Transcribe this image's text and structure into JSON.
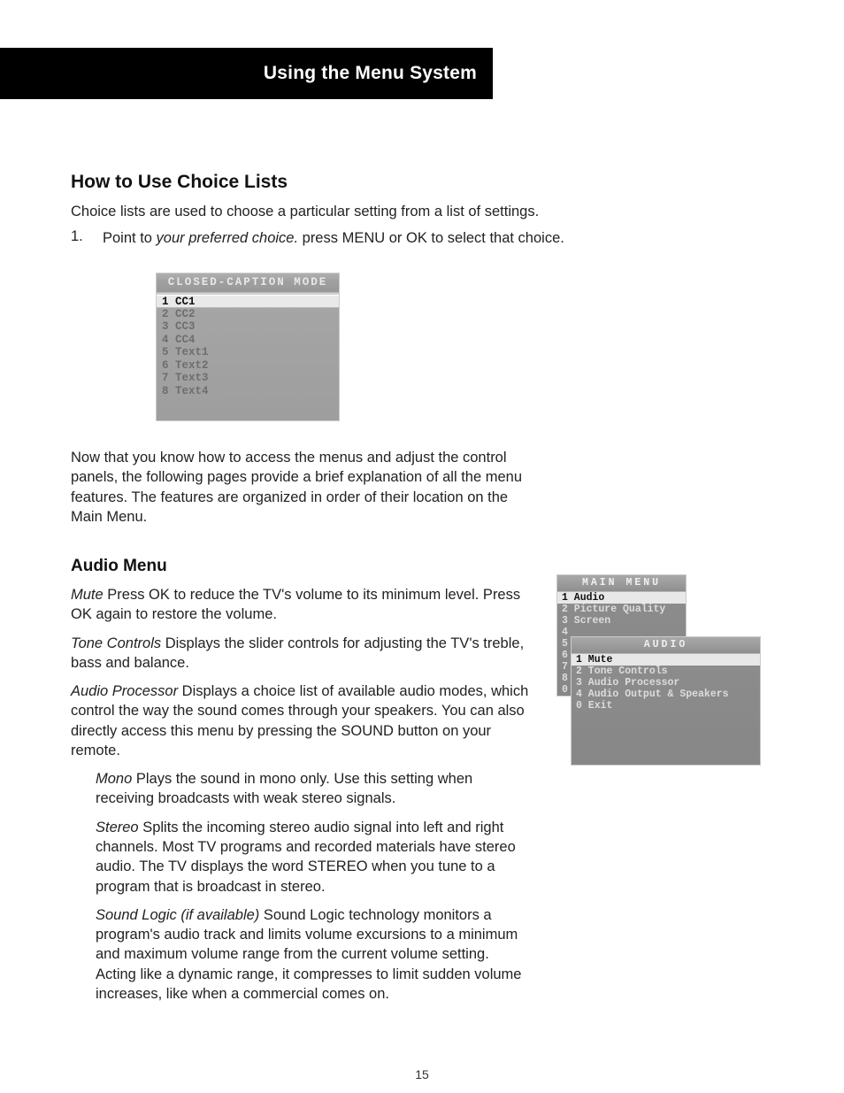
{
  "header": {
    "title": "Using the Menu System"
  },
  "section_choice": {
    "heading": "How to Use Choice Lists",
    "intro": "Choice lists are used to choose a particular setting from a list of settings.",
    "step_num": "1.",
    "step_a": "Point to ",
    "step_b_italic": "your preferred choice. ",
    "step_c": "press MENU or OK to select that choice."
  },
  "cc_panel": {
    "title": "CLOSED-CAPTION MODE",
    "items": [
      {
        "n": "1",
        "label": "CC1",
        "sel": true
      },
      {
        "n": "2",
        "label": "CC2",
        "sel": false
      },
      {
        "n": "3",
        "label": "CC3",
        "sel": false
      },
      {
        "n": "4",
        "label": "CC4",
        "sel": false
      },
      {
        "n": "5",
        "label": "Text1",
        "sel": false
      },
      {
        "n": "6",
        "label": "Text2",
        "sel": false
      },
      {
        "n": "7",
        "label": "Text3",
        "sel": false
      },
      {
        "n": "8",
        "label": "Text4",
        "sel": false
      }
    ]
  },
  "transition": "Now that you know how to access the menus and adjust the control panels, the following pages provide a brief explanation of all the menu features. The features are organized in order of their location on the Main Menu.",
  "audio_heading": "Audio Menu",
  "defs": {
    "mute_term": "Mute",
    "mute_body": " Press OK to reduce the TV's volume to its minimum level. Press OK again to restore the volume.",
    "tone_term": "Tone Controls",
    "tone_body": " Displays the slider controls for adjusting the TV's treble, bass and balance.",
    "proc_term": "Audio Processor",
    "proc_body": " Displays a choice list of available audio modes, which control the way the sound comes through your speakers. You can also directly access this menu by pressing the SOUND button on your remote.",
    "mono_term": "Mono",
    "mono_body": " Plays the sound in mono only. Use this setting when receiving broadcasts with weak stereo signals.",
    "stereo_term": "Stereo",
    "stereo_body": " Splits the incoming stereo audio signal into left and right channels. Most TV programs and recorded materials have stereo audio. The TV displays the word STEREO when you tune to a program that is broadcast in stereo.",
    "sl_term": "Sound Logic (if available)",
    "sl_body": " Sound Logic technology monitors a program's audio track and limits volume excursions to a minimum and maximum volume range from the current volume setting. Acting like a dynamic range, it compresses to limit sudden volume increases, like when a commercial comes on."
  },
  "main_menu": {
    "title": "MAIN MENU",
    "items": [
      {
        "n": "1",
        "label": "Audio",
        "sel": true
      },
      {
        "n": "2",
        "label": "Picture Quality",
        "sel": false
      },
      {
        "n": "3",
        "label": "Screen",
        "sel": false
      },
      {
        "n": "4",
        "label": "",
        "sel": false
      },
      {
        "n": "5",
        "label": "",
        "sel": false
      },
      {
        "n": "6",
        "label": "",
        "sel": false
      },
      {
        "n": "7",
        "label": "",
        "sel": false
      },
      {
        "n": "8",
        "label": "",
        "sel": false
      },
      {
        "n": "0",
        "label": "",
        "sel": false
      }
    ]
  },
  "audio_menu": {
    "title": "AUDIO",
    "items": [
      {
        "n": "1",
        "label": "Mute",
        "sel": true
      },
      {
        "n": "2",
        "label": "Tone Controls",
        "sel": false
      },
      {
        "n": "3",
        "label": "Audio Processor",
        "sel": false
      },
      {
        "n": "4",
        "label": "Audio Output & Speakers",
        "sel": false
      },
      {
        "n": "0",
        "label": "Exit",
        "sel": false
      }
    ]
  },
  "page_number": "15"
}
